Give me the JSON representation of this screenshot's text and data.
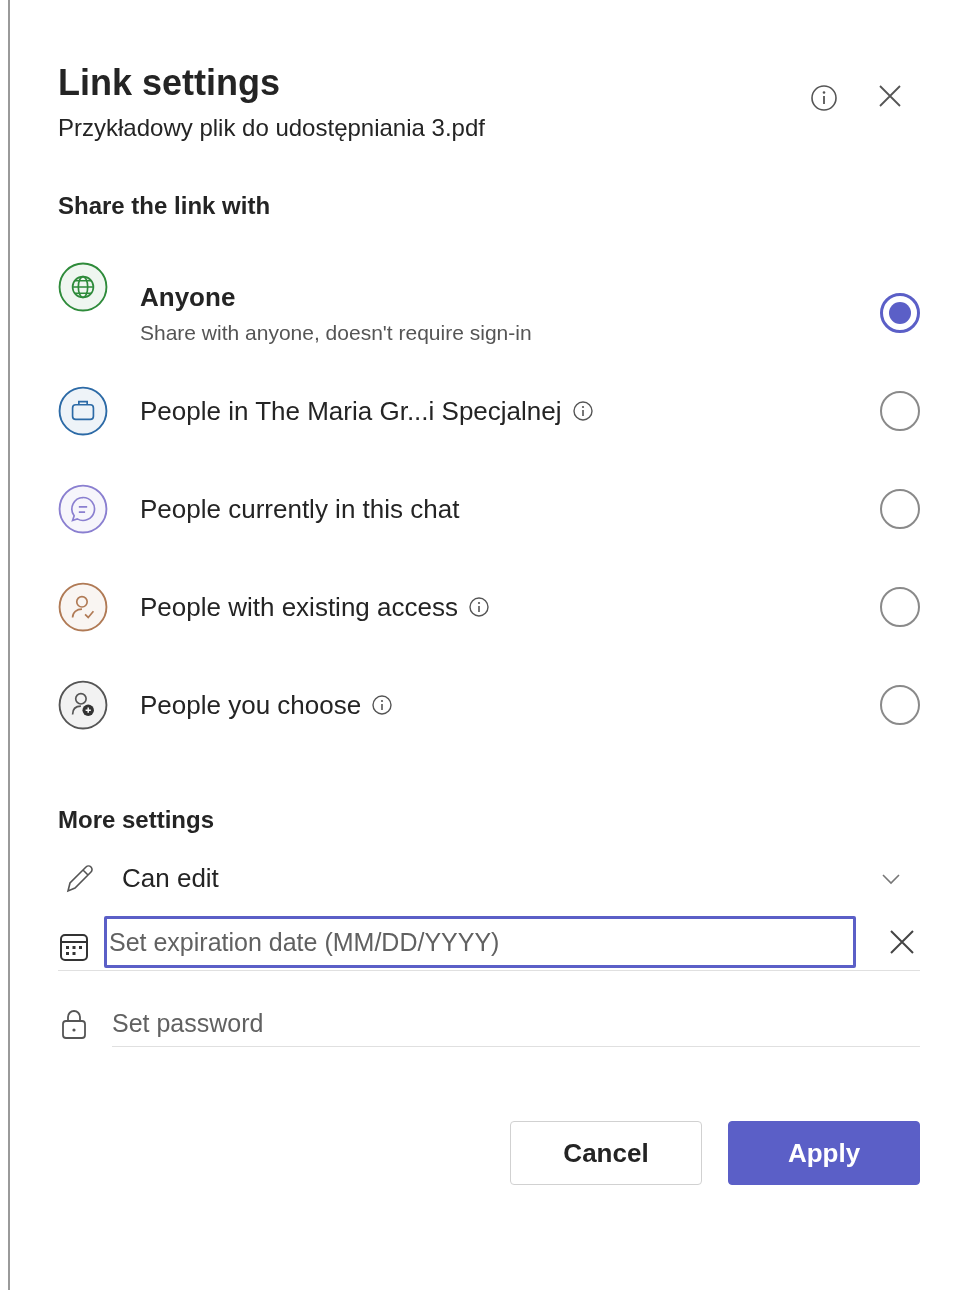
{
  "dialog": {
    "title": "Link settings",
    "subtitle": "Przykładowy plik do udostępniania 3.pdf"
  },
  "share_section": {
    "heading": "Share the link with",
    "options": [
      {
        "kind": "globe",
        "label": "Anyone",
        "description": "Share with anyone, doesn't require sign-in",
        "info": false,
        "selected": true
      },
      {
        "kind": "briefcase",
        "label": "People in The Maria Gr...i Specjalnej",
        "info": true,
        "selected": false
      },
      {
        "kind": "chat",
        "label": "People currently in this chat",
        "info": false,
        "selected": false
      },
      {
        "kind": "person",
        "label": "People with existing access",
        "info": true,
        "selected": false
      },
      {
        "kind": "person-add",
        "label": "People you choose",
        "info": true,
        "selected": false
      }
    ]
  },
  "more_settings": {
    "heading": "More settings",
    "permission": "Can edit",
    "expiration": {
      "placeholder": "Set expiration date (MM/DD/YYYY)",
      "focused": true
    },
    "password": {
      "placeholder": "Set password"
    }
  },
  "buttons": [
    {
      "label": "Cancel",
      "kind": "secondary"
    },
    {
      "label": "Apply",
      "kind": "primary"
    }
  ]
}
